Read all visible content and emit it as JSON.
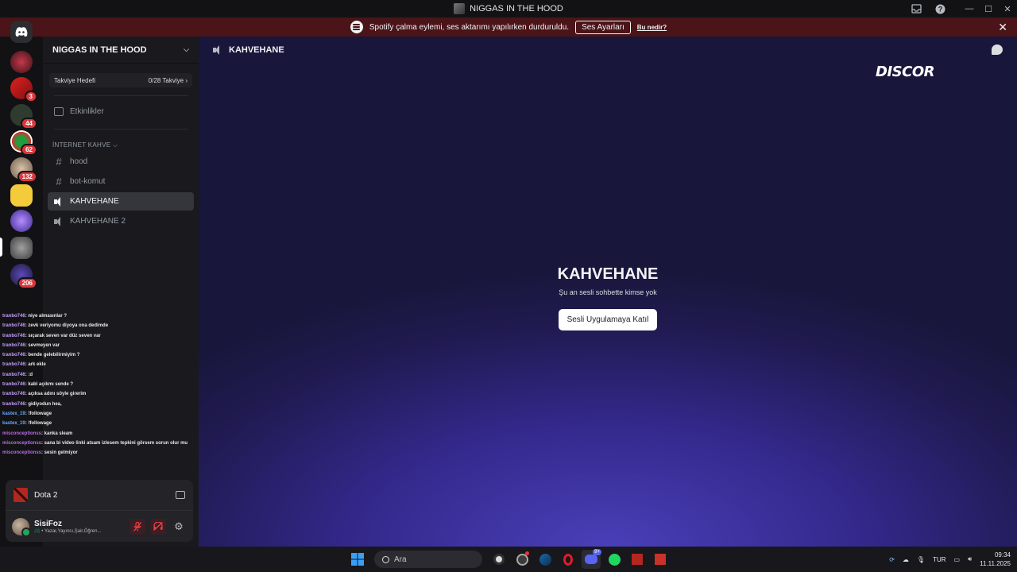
{
  "window": {
    "title": "NIGGAS IN THE HOOD"
  },
  "banner": {
    "message": "Spotify çalma eylemi, ses aktarımı yapılırken durduruldu.",
    "button": "Ses Ayarları",
    "link": "Bu nedir?"
  },
  "servers": [
    {
      "name": "server-1",
      "badge": ""
    },
    {
      "name": "server-2",
      "badge": "3"
    },
    {
      "name": "server-3",
      "badge": "44"
    },
    {
      "name": "server-4",
      "badge": "62"
    },
    {
      "name": "server-5",
      "badge": "132"
    },
    {
      "name": "server-6",
      "badge": ""
    },
    {
      "name": "server-7",
      "badge": ""
    },
    {
      "name": "server-8",
      "badge": ""
    },
    {
      "name": "server-9",
      "badge": "206"
    }
  ],
  "guild": {
    "name": "NIGGAS IN THE HOOD",
    "boost_label": "Takviye Hedefi",
    "boost_value": "0/28 Takviye",
    "events": "Etkinlikler",
    "category": "İNTERNET KAHVE",
    "channels": {
      "hood": "hood",
      "bot": "bot-komut",
      "voice1": "KAHVEHANE",
      "voice2": "KAHVEHANE 2"
    }
  },
  "overlay_chat": [
    {
      "user": "tranbo746",
      "text": ": niye almasınlar ?"
    },
    {
      "user": "tranbo746",
      "text": ": zevk veriyomu diyoya ona dedimde"
    },
    {
      "user": "tranbo746",
      "text": ": sıçarak seven var düz seven var"
    },
    {
      "user": "tranbo746",
      "text": ": sevmeyen var"
    },
    {
      "user": "tranbo746",
      "text": ": bende gelebilirmiyim ?"
    },
    {
      "user": "tranbo746",
      "text": ": ark ekle"
    },
    {
      "user": "tranbo746",
      "text": ": :d"
    },
    {
      "user": "tranbo746",
      "text": ": kabl açıkmı sende ?"
    },
    {
      "user": "tranbo746",
      "text": ": açıksa adını söyle girerim"
    },
    {
      "user": "tranbo746",
      "text": ": gidiyodun hea,"
    },
    {
      "user": "kastex_19",
      "text": ": !followage"
    },
    {
      "user": "kastex_19",
      "text": ": !followage"
    },
    {
      "user": "misconceptionss",
      "text": ": kanka sleam"
    },
    {
      "user": "misconceptionss",
      "text": ": sana bi video linki atsam izlesem tepkini görsem sorun olur mu"
    },
    {
      "user": "misconceptionss",
      "text": ": sesin gelmiyor"
    }
  ],
  "activity": {
    "game": "Dota 2"
  },
  "user": {
    "name": "SisiFoz",
    "status": "• Yazar,Yayıncı,Şair,Öğren..."
  },
  "main": {
    "channel": "KAHVEHANE",
    "logo_text": "DISCOR",
    "title": "KAHVEHANE",
    "subtitle": "Şu an sesli sohbette kimse yok",
    "join_button": "Sesli Uygulamaya Katıl"
  },
  "taskbar": {
    "search_placeholder": "Ara",
    "lang": "TUR",
    "time": "09:34",
    "date": "11.11.2025",
    "discord_badge": "9+"
  },
  "colors": {
    "banner": "#4a1418",
    "accent": "#5865f2",
    "mute": "#f23f43"
  }
}
